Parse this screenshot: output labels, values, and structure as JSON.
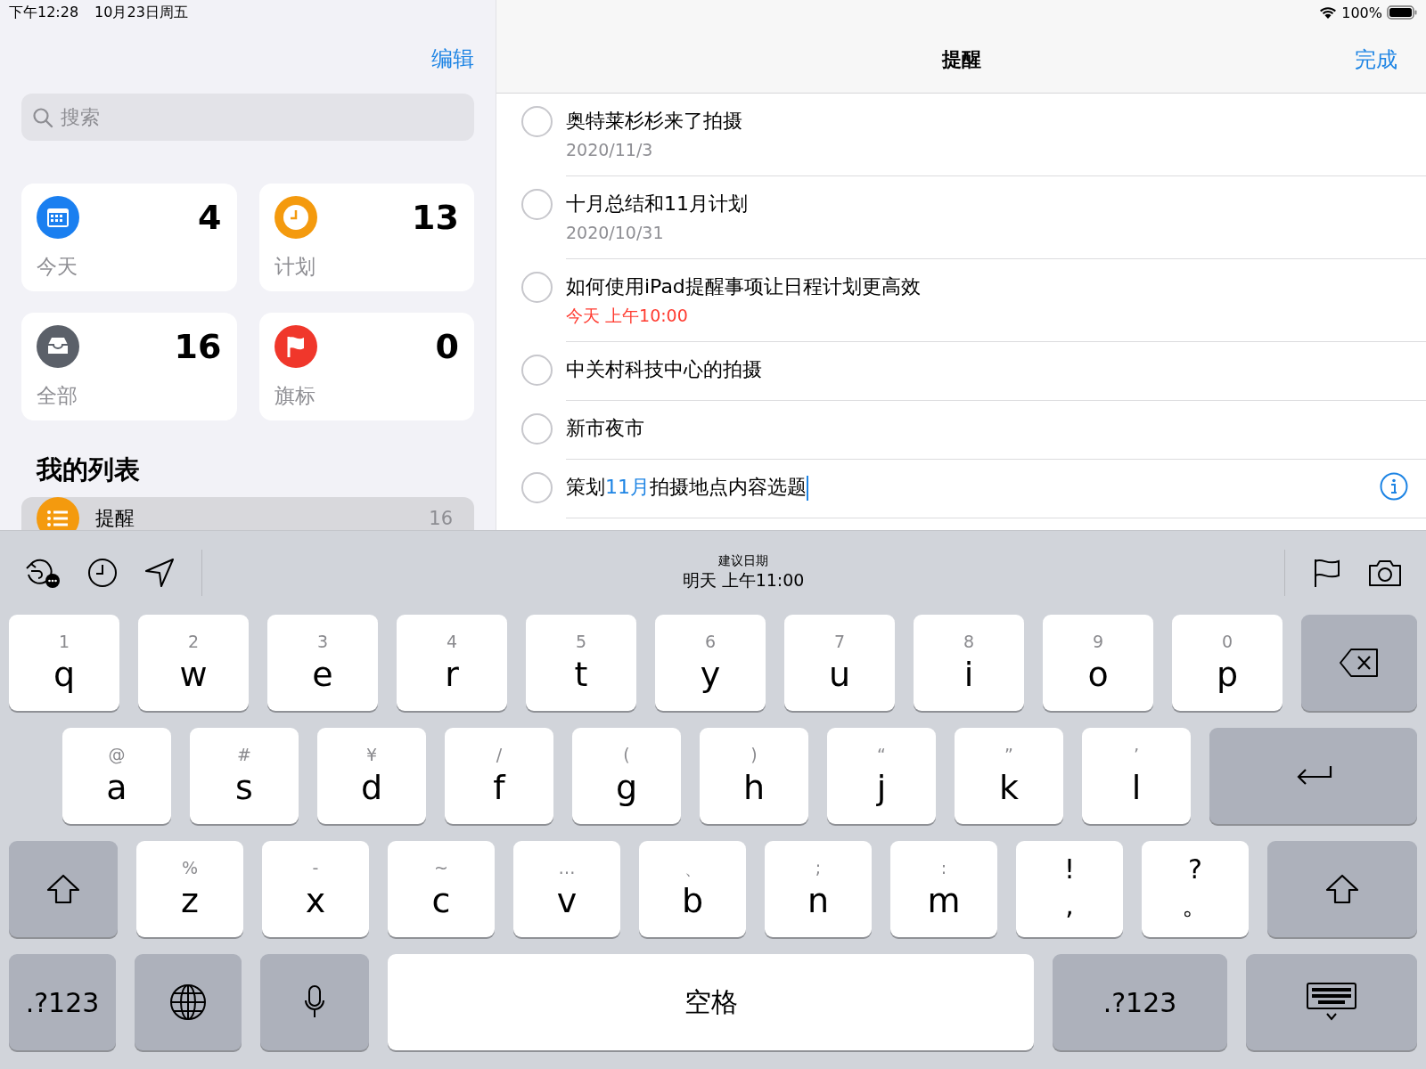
{
  "status_bar": {
    "time": "下午12:28",
    "date": "10月23日周五",
    "battery": "100%"
  },
  "sidebar": {
    "edit_button": "编辑",
    "search": {
      "placeholder": "搜索"
    },
    "smart_lists": [
      {
        "kind": "today",
        "count": "4",
        "label": "今天"
      },
      {
        "kind": "scheduled",
        "count": "13",
        "label": "计划"
      },
      {
        "kind": "all",
        "count": "16",
        "label": "全部"
      },
      {
        "kind": "flagged",
        "count": "0",
        "label": "旗标"
      }
    ],
    "section_title": "我的列表",
    "lists": [
      {
        "name": "提醒",
        "count": "16",
        "selected": true
      }
    ]
  },
  "detail": {
    "title": "提醒",
    "done_button": "完成",
    "reminders": [
      {
        "completed": false,
        "editing": false,
        "title": [
          {
            "text": "奥特莱杉杉来了拍摄",
            "highlight": false
          }
        ],
        "subtitle": {
          "text": "2020/11/3",
          "kind": "date"
        }
      },
      {
        "completed": false,
        "editing": false,
        "title": [
          {
            "text": "十月总结和11月计划",
            "highlight": false
          }
        ],
        "subtitle": {
          "text": "2020/10/31",
          "kind": "date"
        }
      },
      {
        "completed": false,
        "editing": false,
        "title": [
          {
            "text": "如何使用iPad提醒事项让日程计划更高效",
            "highlight": false
          }
        ],
        "subtitle": {
          "text": "今天 上午10:00",
          "kind": "today"
        }
      },
      {
        "completed": false,
        "editing": false,
        "title": [
          {
            "text": "中关村科技中心的拍摄",
            "highlight": false
          }
        ]
      },
      {
        "completed": false,
        "editing": false,
        "title": [
          {
            "text": "新市夜市",
            "highlight": false
          }
        ]
      },
      {
        "completed": false,
        "editing": true,
        "title": [
          {
            "text": "策划",
            "highlight": false
          },
          {
            "text": "11月",
            "highlight": true
          },
          {
            "text": "拍摄地点内容选题",
            "highlight": false
          }
        ]
      }
    ]
  },
  "keyboard": {
    "toolbar": {
      "suggestion_label": "建议日期",
      "suggestion_value": "明天 上午11:00"
    },
    "top_row": [
      {
        "kind": "letter",
        "hint": "1",
        "label": "q"
      },
      {
        "kind": "letter",
        "hint": "2",
        "label": "w"
      },
      {
        "kind": "letter",
        "hint": "3",
        "label": "e"
      },
      {
        "kind": "letter",
        "hint": "4",
        "label": "r"
      },
      {
        "kind": "letter",
        "hint": "5",
        "label": "t"
      },
      {
        "kind": "letter",
        "hint": "6",
        "label": "y"
      },
      {
        "kind": "letter",
        "hint": "7",
        "label": "u"
      },
      {
        "kind": "letter",
        "hint": "8",
        "label": "i"
      },
      {
        "kind": "letter",
        "hint": "9",
        "label": "o"
      },
      {
        "kind": "letter",
        "hint": "0",
        "label": "p"
      },
      {
        "kind": "delete"
      }
    ],
    "home_row": [
      {
        "kind": "letter",
        "hint": "@",
        "label": "a"
      },
      {
        "kind": "letter",
        "hint": "#",
        "label": "s"
      },
      {
        "kind": "letter",
        "hint": "¥",
        "label": "d"
      },
      {
        "kind": "letter",
        "hint": "/",
        "label": "f"
      },
      {
        "kind": "letter",
        "hint": "(",
        "label": "g"
      },
      {
        "kind": "letter",
        "hint": ")",
        "label": "h"
      },
      {
        "kind": "letter",
        "hint": "“",
        "label": "j"
      },
      {
        "kind": "letter",
        "hint": "”",
        "label": "k"
      },
      {
        "kind": "letter",
        "hint": "’",
        "label": "l"
      },
      {
        "kind": "return"
      }
    ],
    "shift_row": [
      {
        "kind": "shift"
      },
      {
        "kind": "letter",
        "hint": "%",
        "label": "z"
      },
      {
        "kind": "letter",
        "hint": "-",
        "label": "x"
      },
      {
        "kind": "letter",
        "hint": "~",
        "label": "c"
      },
      {
        "kind": "letter",
        "hint": "…",
        "label": "v"
      },
      {
        "kind": "letter",
        "hint": "、",
        "label": "b"
      },
      {
        "kind": "letter",
        "hint": ";",
        "label": "n"
      },
      {
        "kind": "letter",
        "hint": ":",
        "label": "m"
      },
      {
        "kind": "punct",
        "hint": "!",
        "label": ","
      },
      {
        "kind": "punct",
        "hint": "?",
        "label": "。"
      },
      {
        "kind": "shift"
      }
    ],
    "bottom_row": [
      {
        "kind": "mode",
        "label": ".?123"
      },
      {
        "kind": "globe"
      },
      {
        "kind": "mic"
      },
      {
        "kind": "space",
        "label": "空格"
      },
      {
        "kind": "mode-wide",
        "label": ".?123"
      },
      {
        "kind": "dismiss"
      }
    ]
  }
}
